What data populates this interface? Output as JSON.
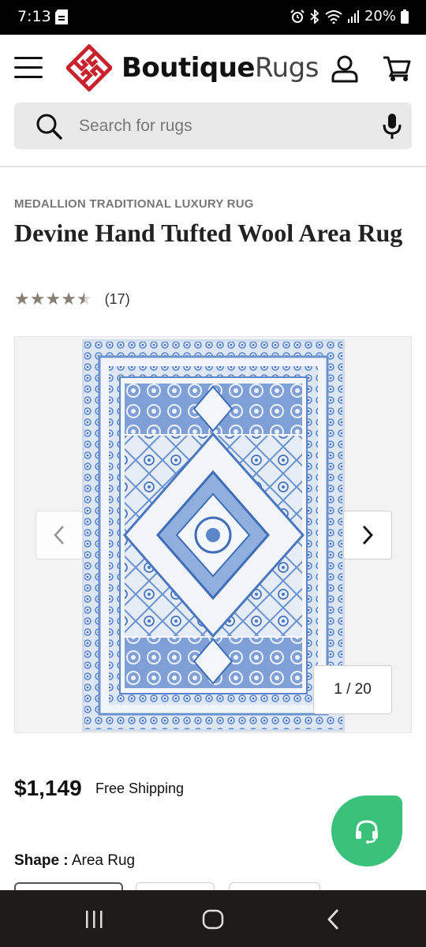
{
  "status_bar": {
    "time": "7:13",
    "battery": "20%",
    "icons": [
      "sd-card-icon",
      "alarm-icon",
      "bluetooth-icon",
      "wifi-icon",
      "signal-icon",
      "battery-icon"
    ]
  },
  "header": {
    "logo_bold": "Boutique",
    "logo_light": "Rugs",
    "icons": [
      "menu-icon",
      "account-icon",
      "cart-icon"
    ]
  },
  "search": {
    "placeholder": "Search for rugs",
    "value": ""
  },
  "product": {
    "category": "MEDALLION TRADITIONAL LUXURY RUG",
    "title": "Devine Hand Tufted Wool Area Rug",
    "rating": 4.5,
    "review_count": "(17)",
    "price": "$1,149",
    "shipping": "Free Shipping",
    "shape_label": "Shape :",
    "shape_value": "Area Rug"
  },
  "gallery": {
    "counter": "1 / 20"
  },
  "colors": {
    "accent_red": "#c8232c",
    "chat_green": "#3ac17a",
    "star": "#8a7f74",
    "rug_blue": "#5b86c8"
  }
}
